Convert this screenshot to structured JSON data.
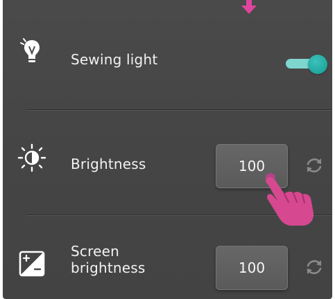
{
  "settings": {
    "sewing_light": {
      "label": "Sewing light",
      "toggle_on": true
    },
    "brightness": {
      "label": "Brightness",
      "value": "100"
    },
    "screen_brightness": {
      "label": "Screen brightness",
      "value": "100"
    }
  },
  "icons": {
    "light": "lightbulb-icon",
    "brightness": "sun-icon",
    "screen": "exposure-icon",
    "reset": "refresh-icon",
    "pointer": "arrow-down-icon",
    "hand": "hand-pointer-icon"
  },
  "colors": {
    "panel": "#4a4a4a",
    "toggle_track": "#7fd6cf",
    "toggle_knob": "#1fa89f",
    "pointer": "#e0459c",
    "text": "#f2f2f2"
  }
}
